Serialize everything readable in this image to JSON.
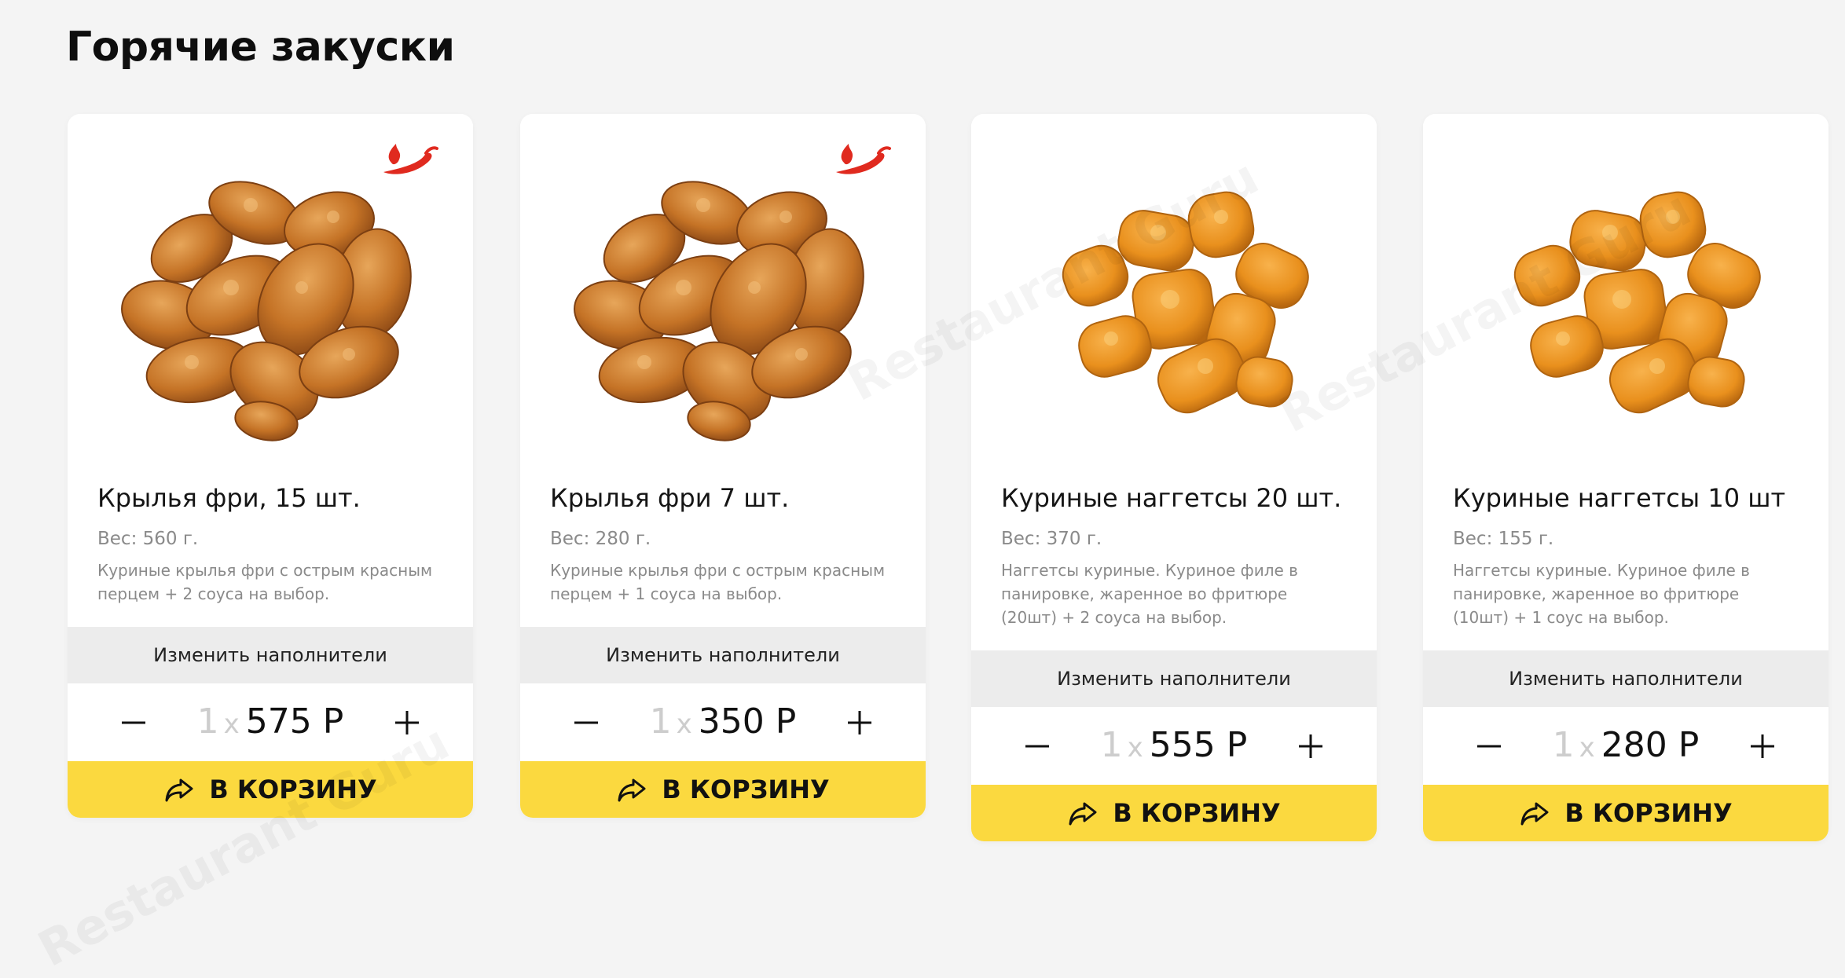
{
  "section": {
    "title": "Горячие закуски"
  },
  "products": [
    {
      "title": "Крылья фри, 15 шт.",
      "weight": "Вес: 560 г.",
      "description": "Куриные крылья фри с острым красным перцем + 2 соуса на выбор.",
      "spicy": true,
      "image_icon": "chicken-wings-icon",
      "modify_label": "Изменить наполнители",
      "quantity": "1",
      "times": "x",
      "price": "575 Р",
      "cart_label": "В КОРЗИНУ"
    },
    {
      "title": "Крылья фри 7 шт.",
      "weight": "Вес: 280 г.",
      "description": "Куриные крылья фри с острым красным перцем + 1 соуса на выбор.",
      "spicy": true,
      "image_icon": "chicken-wings-icon",
      "modify_label": "Изменить наполнители",
      "quantity": "1",
      "times": "x",
      "price": "350 Р",
      "cart_label": "В КОРЗИНУ"
    },
    {
      "title": "Куриные наггетсы 20 шт.",
      "weight": "Вес: 370 г.",
      "description": "Наггетсы куриные. Куриное филе в панировке, жаренное во фритюре (20шт) + 2 соуса на выбор.",
      "spicy": false,
      "image_icon": "chicken-nuggets-icon",
      "modify_label": "Изменить наполнители",
      "quantity": "1",
      "times": "x",
      "price": "555 Р",
      "cart_label": "В КОРЗИНУ"
    },
    {
      "title": "Куриные наггетсы 10 шт",
      "weight": "Вес: 155 г.",
      "description": "Наггетсы куриные. Куриное филе в панировке, жаренное во фритюре (10шт) + 1 соус на выбор.",
      "spicy": false,
      "image_icon": "chicken-nuggets-icon",
      "modify_label": "Изменить наполнители",
      "quantity": "1",
      "times": "x",
      "price": "280 Р",
      "cart_label": "В КОРЗИНУ"
    }
  ],
  "colors": {
    "accent_yellow": "#fbd93f",
    "spicy_red": "#e02a1f",
    "muted_text": "#8a8a8a",
    "modify_bg": "#ececec"
  },
  "watermark": "Restaurant Guru"
}
